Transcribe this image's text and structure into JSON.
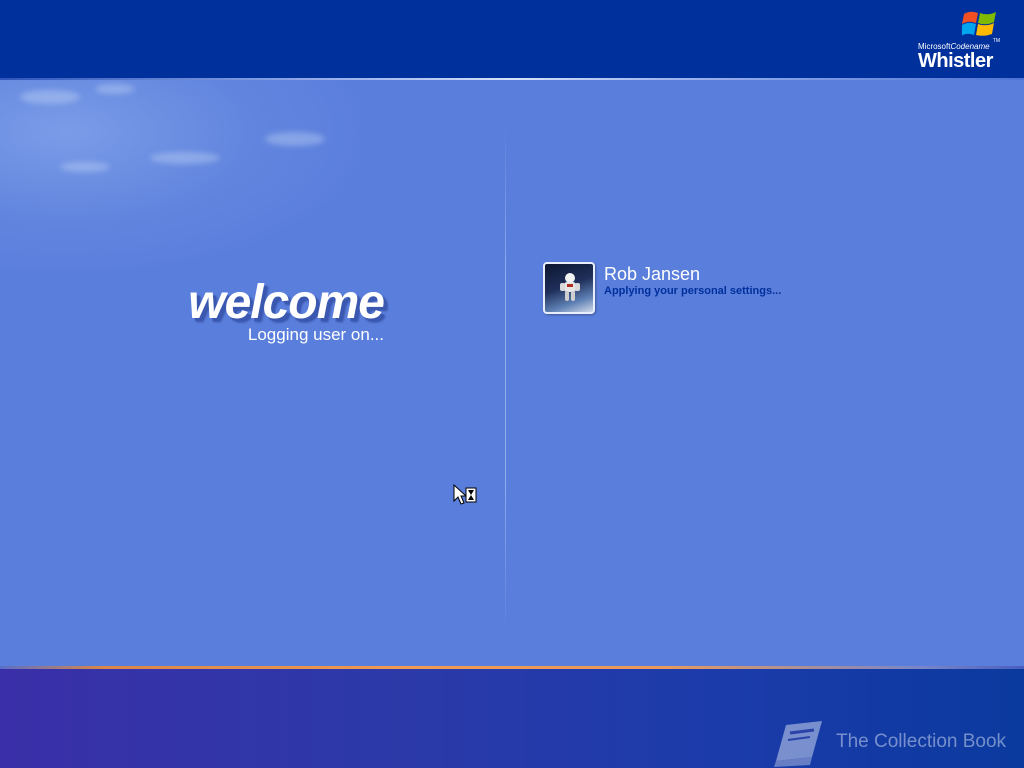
{
  "branding": {
    "company": "Microsoft",
    "codename_label": "Codename",
    "product": "Whistler",
    "trademark": "TM"
  },
  "welcome": {
    "title": "welcome",
    "status": "Logging user on..."
  },
  "user": {
    "name": "Rob Jansen",
    "status": "Applying your personal settings..."
  },
  "watermark": {
    "text": "The Collection Book"
  },
  "colors": {
    "top_bar": "#00309c",
    "main_background": "#5a7edc",
    "status_text": "#00309c",
    "accent_rule": "#f09a52"
  },
  "icons": {
    "logo": "windows-flag-icon",
    "cursor": "busy-cursor-icon",
    "watermark": "book-icon",
    "avatar": "astronaut-avatar"
  }
}
